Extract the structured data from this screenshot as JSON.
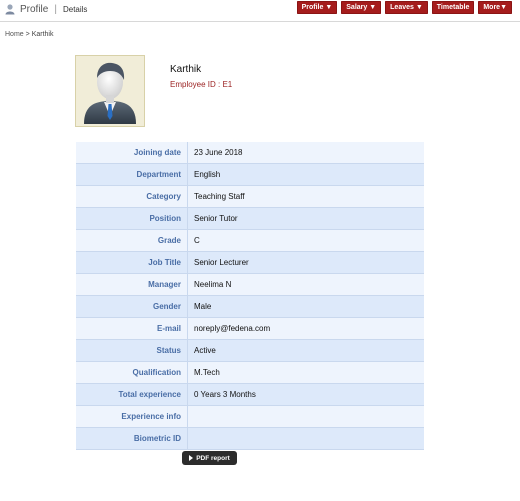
{
  "header": {
    "title": "Profile",
    "separator": "|",
    "subtitle": "Details",
    "menus": [
      "Profile ▼",
      "Salary ▼",
      "Leaves ▼",
      "Timetable",
      "More▼"
    ]
  },
  "breadcrumb": {
    "home": "Home",
    "separator": ">",
    "current": "Karthik"
  },
  "profile": {
    "name": "Karthik",
    "employee_id": "Employee ID : E1"
  },
  "details": [
    {
      "label": "Joining date",
      "value": "23 June 2018"
    },
    {
      "label": "Department",
      "value": "English"
    },
    {
      "label": "Category",
      "value": "Teaching Staff"
    },
    {
      "label": "Position",
      "value": "Senior Tutor"
    },
    {
      "label": "Grade",
      "value": "C"
    },
    {
      "label": "Job Title",
      "value": "Senior Lecturer"
    },
    {
      "label": "Manager",
      "value": "Neelima N"
    },
    {
      "label": "Gender",
      "value": "Male"
    },
    {
      "label": "E-mail",
      "value": "noreply@fedena.com"
    },
    {
      "label": "Status",
      "value": "Active"
    },
    {
      "label": "Qualification",
      "value": "M.Tech"
    },
    {
      "label": "Total experience",
      "value": "0 Years 3 Months"
    },
    {
      "label": "Experience info",
      "value": ""
    },
    {
      "label": "Biometric ID",
      "value": ""
    }
  ],
  "actions": {
    "pdf_report": "PDF report"
  },
  "colors": {
    "menu_bg": "#a51c1c",
    "label_text": "#4a6ea6",
    "employee_id": "#9a1f1f"
  },
  "icons": {
    "header": "user-icon",
    "avatar": "person-silhouette-icon",
    "pdf": "play-arrow-icon"
  }
}
